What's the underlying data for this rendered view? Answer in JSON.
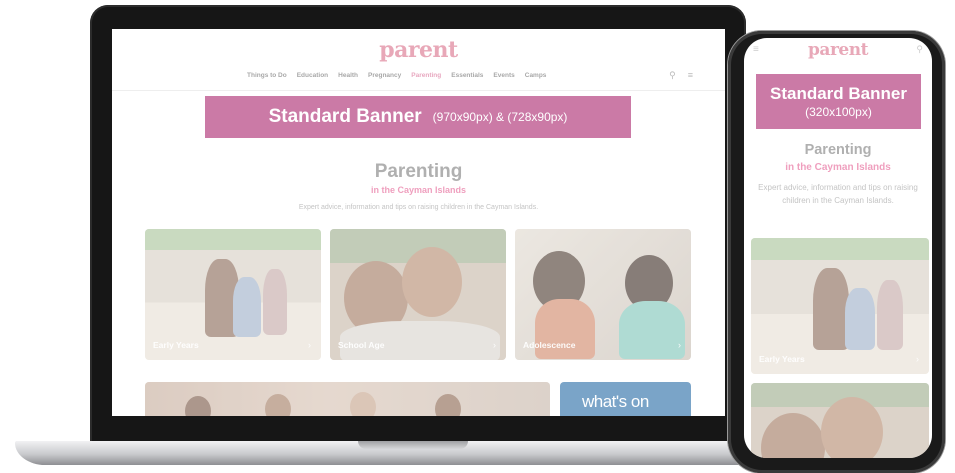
{
  "site": {
    "logo": "parent",
    "nav": [
      "Things to Do",
      "Education",
      "Health",
      "Pregnancy",
      "Parenting",
      "Essentials",
      "Events",
      "Camps"
    ],
    "active_nav": "Parenting"
  },
  "icons": {
    "search": "search-icon",
    "menu": "hamburger-menu-icon",
    "chevron": "chevron-right-icon"
  },
  "colors": {
    "banner": "#cb7aa6",
    "accent": "#ef9fbe",
    "logo": "#e8a8b8"
  },
  "desktop_banner": {
    "title": "Standard Banner",
    "size": "(970x90px) & (728x90px)"
  },
  "mobile_banner": {
    "title": "Standard Banner",
    "size": "(320x100px)"
  },
  "page": {
    "title": "Parenting",
    "subtitle": "in the Cayman Islands",
    "description": "Expert advice, information and tips on raising children in the Cayman Islands."
  },
  "cards": {
    "early": "Early Years",
    "school": "School Age",
    "adolescence": "Adolescence",
    "whats_on": "what's on"
  },
  "glyphs": {
    "search": "⚲",
    "menu": "≡",
    "chevron": "›"
  }
}
